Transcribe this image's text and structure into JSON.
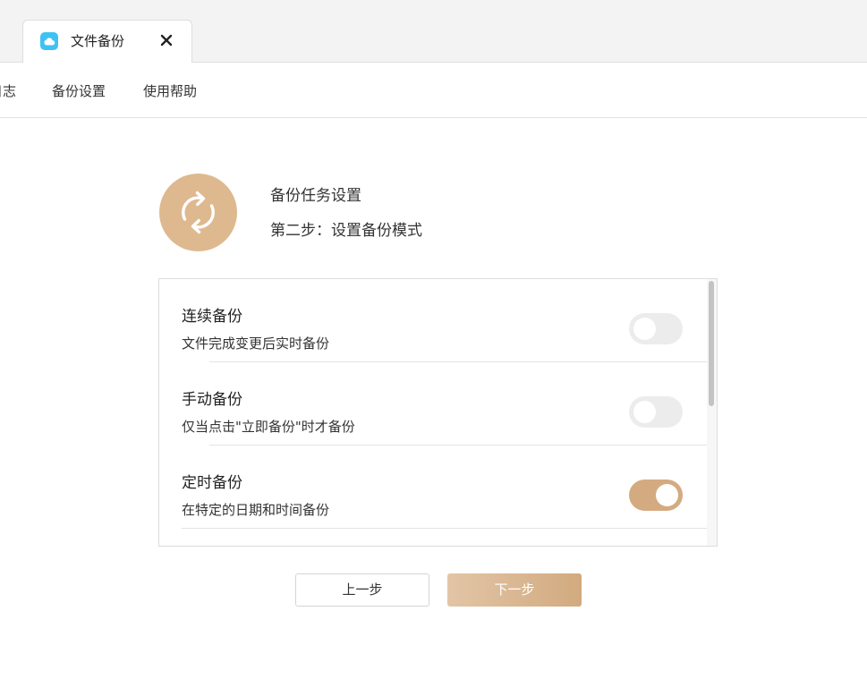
{
  "tab": {
    "title": "文件备份",
    "icon": "cloud-icon",
    "close_icon": "close-icon"
  },
  "menu": {
    "items": [
      "日志",
      "备份设置",
      "使用帮助"
    ]
  },
  "header": {
    "title": "备份任务设置",
    "step": "第二步：设置备份模式",
    "icon": "sync-icon"
  },
  "options": [
    {
      "title": "连续备份",
      "desc": "文件完成变更后实时备份",
      "enabled": false
    },
    {
      "title": "手动备份",
      "desc": "仅当点击\"立即备份\"时才备份",
      "enabled": false
    },
    {
      "title": "定时备份",
      "desc": "在特定的日期和时间备份",
      "enabled": true
    }
  ],
  "buttons": {
    "prev": "上一步",
    "next": "下一步"
  },
  "colors": {
    "accent": "#d4ab80",
    "icon_bg": "#deb98f",
    "tab_icon": "#3ec2f2",
    "toggle_off": "#ececec"
  }
}
